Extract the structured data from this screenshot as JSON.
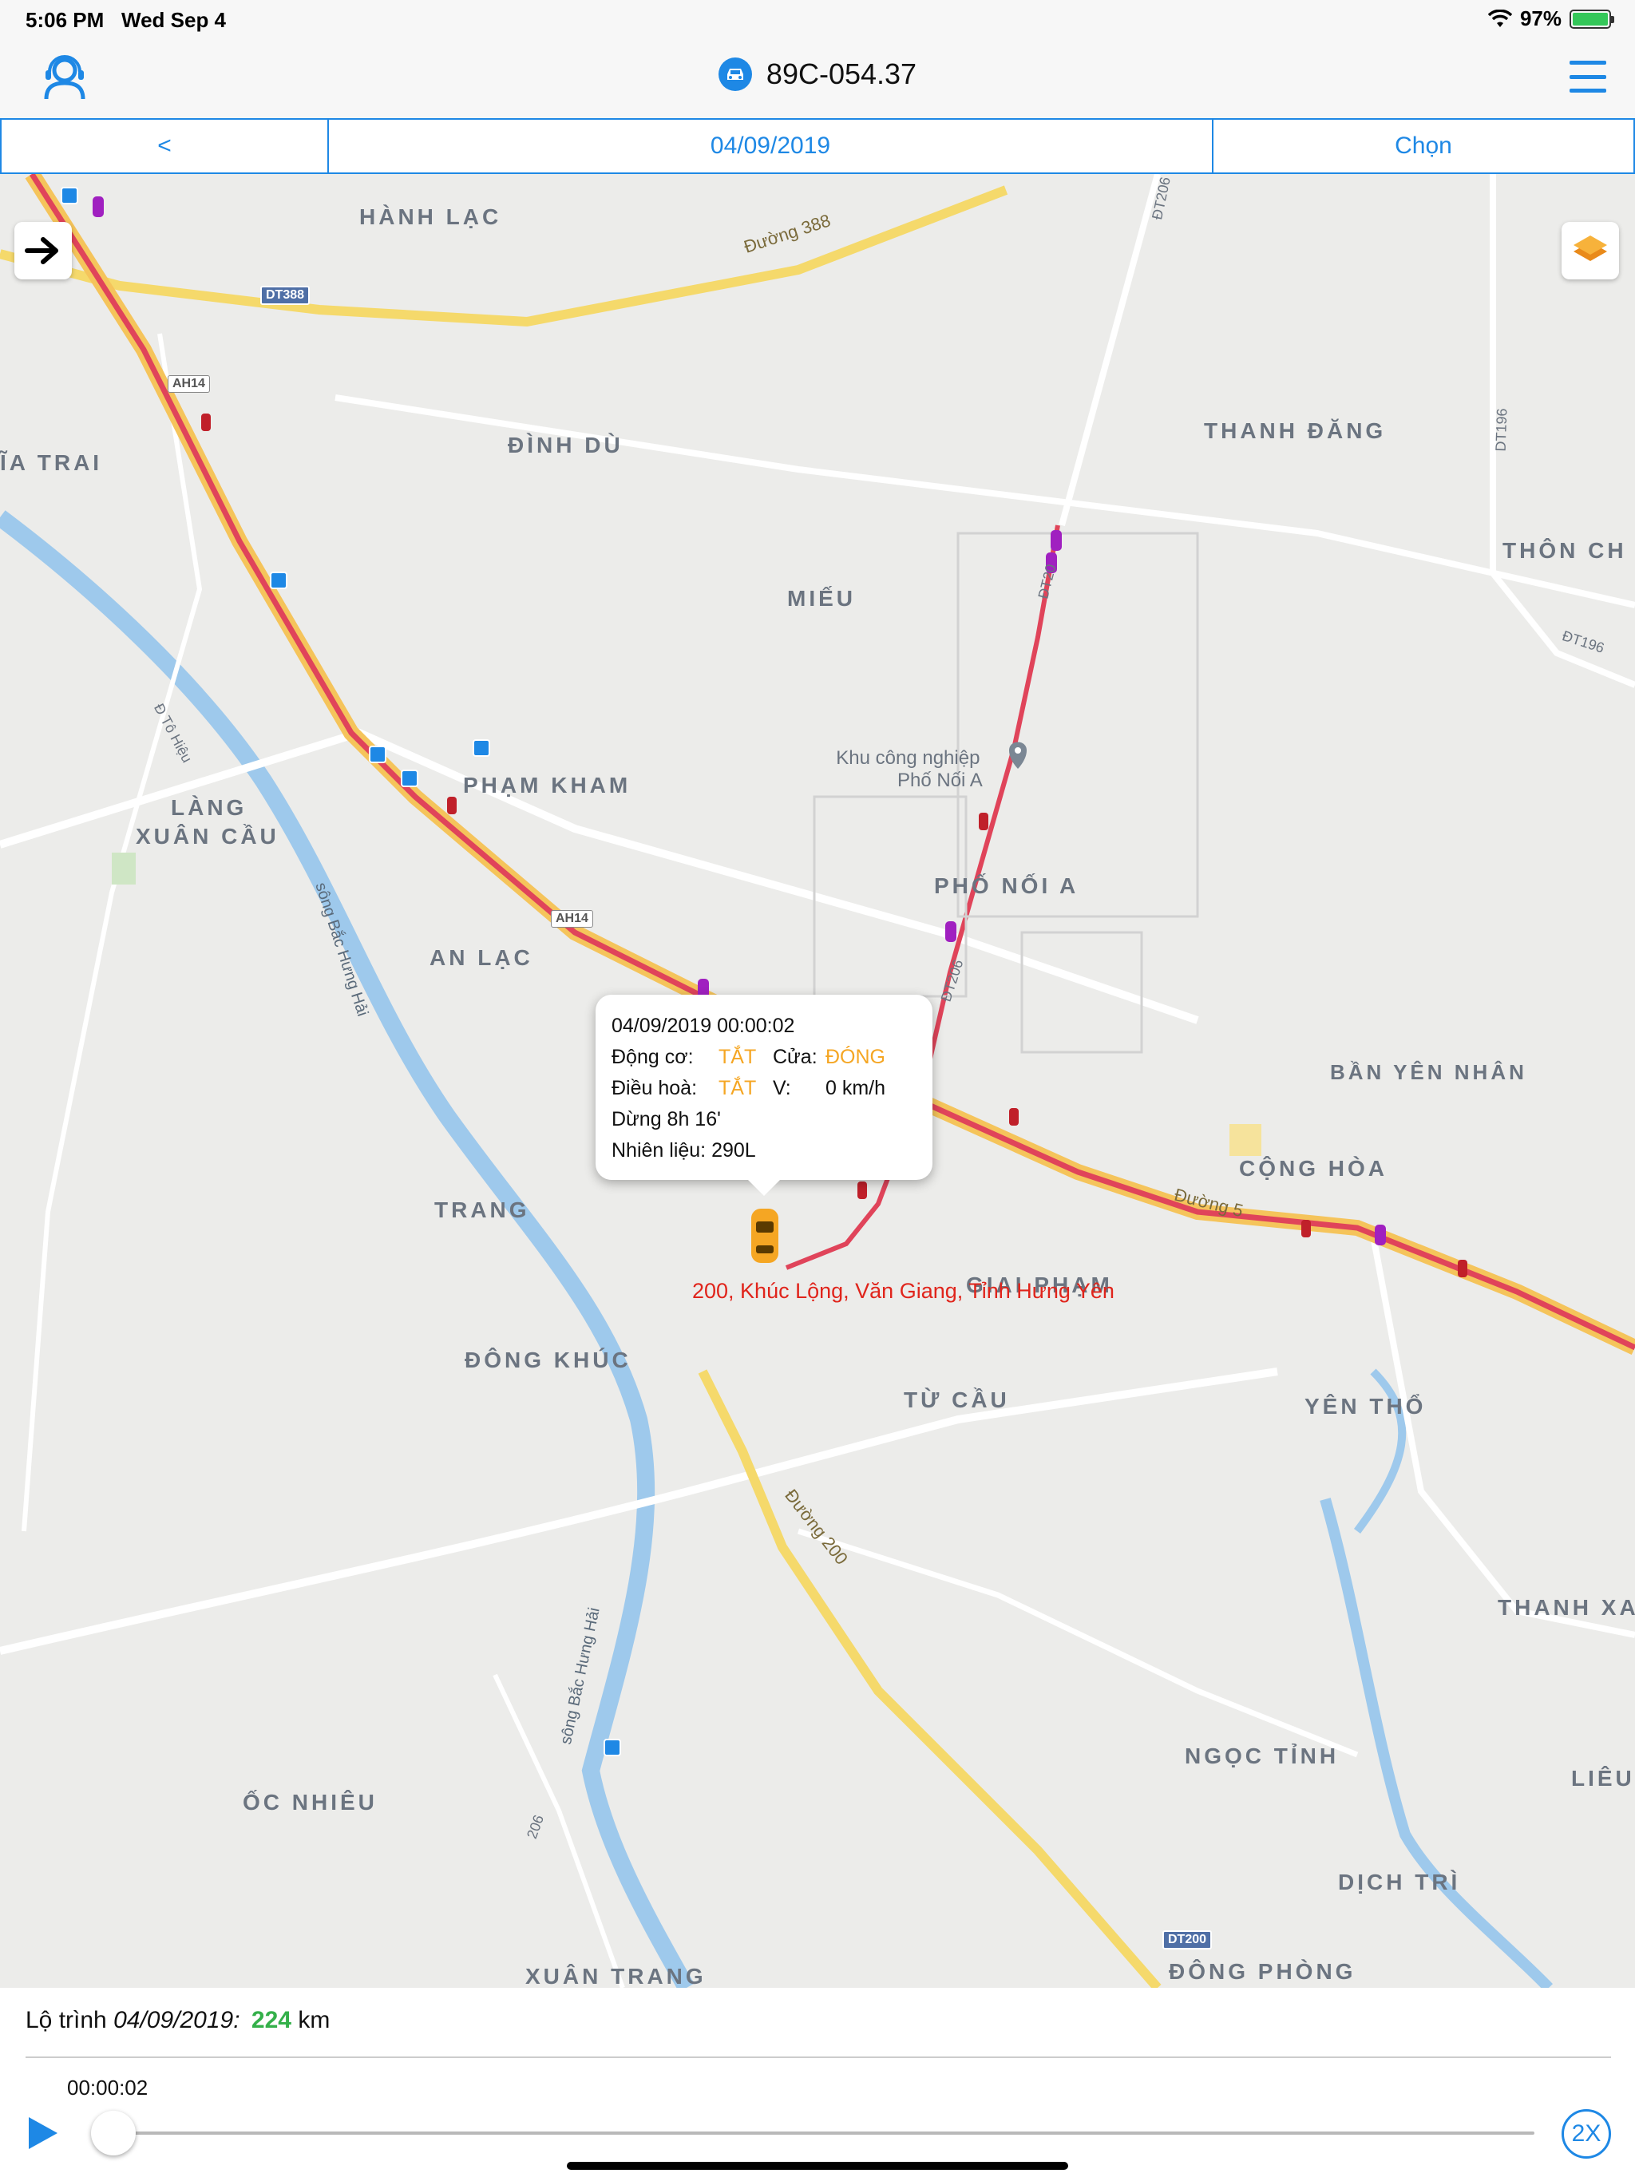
{
  "status_bar": {
    "time": "5:06 PM",
    "date": "Wed Sep 4",
    "battery": "97%"
  },
  "header": {
    "vehicle_plate": "89C-054.37"
  },
  "date_bar": {
    "prev_label": "<",
    "date": "04/09/2019",
    "choose_label": "Chọn"
  },
  "map": {
    "places": [
      "HÀNH LẠC",
      "ĐÌNH DÙ",
      "THANH ĐĂNG",
      "ĨA TRAI",
      "THÔN CH",
      "MIẾU",
      "PHẠM KHAM",
      "LÀNG",
      "XUÂN CẦU",
      "PHỐ NỐI A",
      "AN LẠC",
      "BẦN YÊN NHÂN",
      "CỘNG HÒA",
      "TRANG",
      "GIAI PHẠM",
      "ĐÔNG KHÚC",
      "TỪ CẦU",
      "YÊN THỔ",
      "THANH XA",
      "NGỌC TỈNH",
      "LIÊU",
      "ỐC NHIÊU",
      "DỊCH TRÌ",
      "XUÂN TRANG",
      "ĐÔNG PHÒNG"
    ],
    "roads": [
      "Đường 388",
      "DT388",
      "AH14",
      "ĐT206",
      "DT196",
      "ĐT196",
      "Đ Tô Hiệu",
      "sông Bắc Hưng Hải",
      "Đường 5",
      "Đường 200",
      "DT200",
      "206",
      "ĐT20"
    ],
    "poi": {
      "line1": "Khu công nghiệp",
      "line2": "Phố Nối A"
    },
    "popup": {
      "timestamp": "04/09/2019 00:00:02",
      "engine_label": "Động cơ:",
      "engine_value": "TẮT",
      "door_label": "Cửa:",
      "door_value": "ĐÓNG",
      "ac_label": "Điều hoà:",
      "ac_value": "TẮT",
      "speed_label": "V:",
      "speed_value": "0 km/h",
      "stop_time": "Dừng 8h 16'",
      "fuel": "Nhiên liệu: 290L"
    },
    "address": "200, Khúc Lộng, Văn Giang, Tỉnh Hưng Yên"
  },
  "bottom": {
    "route_label": "Lộ trình",
    "route_date": "04/09/2019:",
    "distance_value": "224",
    "distance_unit": "km",
    "elapsed": "00:00:02",
    "speed": "2X",
    "progress": 0
  },
  "colors": {
    "accent": "#1e88e5",
    "route": "#e0445a",
    "highlight": "#f5a623",
    "address": "#e0241b",
    "distance": "#34b04a"
  },
  "icons": [
    "support-agent-icon",
    "car-icon",
    "menu-icon",
    "arrow-right-icon",
    "layers-icon",
    "bus-stop-icon",
    "pin-icon",
    "play-icon"
  ]
}
